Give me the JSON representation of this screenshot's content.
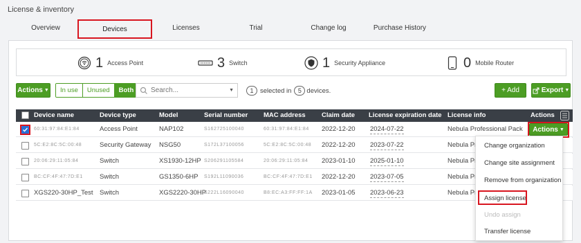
{
  "page": {
    "title": "License & inventory"
  },
  "tabs": [
    {
      "label": "Overview"
    },
    {
      "label": "Devices",
      "active": true
    },
    {
      "label": "Licenses"
    },
    {
      "label": "Trial"
    },
    {
      "label": "Change log"
    },
    {
      "label": "Purchase History"
    }
  ],
  "summary": [
    {
      "icon": "access-point-icon",
      "count": "1",
      "label": "Access Point"
    },
    {
      "icon": "switch-icon",
      "count": "3",
      "label": "Switch"
    },
    {
      "icon": "shield-icon",
      "count": "1",
      "label": "Security Appliance"
    },
    {
      "icon": "mobile-router-icon",
      "count": "0",
      "label": "Mobile Router"
    }
  ],
  "toolbar": {
    "actions_label": "Actions",
    "filters": [
      "In use",
      "Unused",
      "Both"
    ],
    "active_filter": "Both",
    "search_placeholder": "Search...",
    "selected_count": "1",
    "selected_text_1": "selected in",
    "devices_count": "5",
    "selected_text_2": "devices.",
    "add_label": "+ Add",
    "export_label": "Export"
  },
  "table": {
    "columns": [
      "Device name",
      "Device type",
      "Model",
      "Serial number",
      "MAC address",
      "Claim date",
      "License expiration date",
      "License info",
      "Actions"
    ],
    "rows": [
      {
        "name": "60:31:97:84:E1:84",
        "type": "Access Point",
        "model": "NAP102",
        "serial": "S162725100040",
        "mac": "60:31:97:84:E1:84",
        "claim": "2022-12-20",
        "expiry": "2024-07-22",
        "license": "Nebula Professional Pack",
        "checked": true,
        "name_blurred": true
      },
      {
        "name": "5C:E2:8C:5C:00:48",
        "type": "Security Gateway",
        "model": "NSG50",
        "serial": "S172L37100056",
        "mac": "5C:E2:8C:5C:00:48",
        "claim": "2022-12-20",
        "expiry": "2023-07-22",
        "license": "Nebula Pro",
        "checked": false,
        "name_blurred": true
      },
      {
        "name": "20:06:29:11:05:84",
        "type": "Switch",
        "model": "XS1930-12HP",
        "serial": "S206291105584",
        "mac": "20:06:29:11:05:84",
        "claim": "2023-01-10",
        "expiry": "2025-01-10",
        "license": "Nebula Pro",
        "checked": false,
        "name_blurred": true
      },
      {
        "name": "BC:CF:4F:47:7D:E1",
        "type": "Switch",
        "model": "GS1350-6HP",
        "serial": "S192L11090036",
        "mac": "BC:CF:4F:47:7D:E1",
        "claim": "2022-12-20",
        "expiry": "2023-07-05",
        "license": "Nebula Pro",
        "checked": false,
        "name_blurred": true
      },
      {
        "name": "XGS220-30HP_Test",
        "type": "Switch",
        "model": "XGS2220-30HP",
        "serial": "S222L16090040",
        "mac": "B8:EC:A3:FF:FF:1A",
        "claim": "2023-01-05",
        "expiry": "2023-06-23",
        "license": "Nebula Pro",
        "checked": false,
        "name_blurred": false
      }
    ],
    "row_actions_label": "Actions"
  },
  "menu": {
    "items": [
      {
        "label": "Change organization",
        "disabled": false
      },
      {
        "label": "Change site assignment",
        "disabled": false
      },
      {
        "label": "Remove from organization",
        "disabled": false
      },
      {
        "label": "Assign license",
        "disabled": false,
        "highlighted": true
      },
      {
        "label": "Undo assign",
        "disabled": true
      },
      {
        "label": "Transfer license",
        "disabled": false
      }
    ]
  },
  "colors": {
    "accent": "#4c9d24",
    "header": "#3a3f46",
    "highlight": "#d8151f"
  }
}
